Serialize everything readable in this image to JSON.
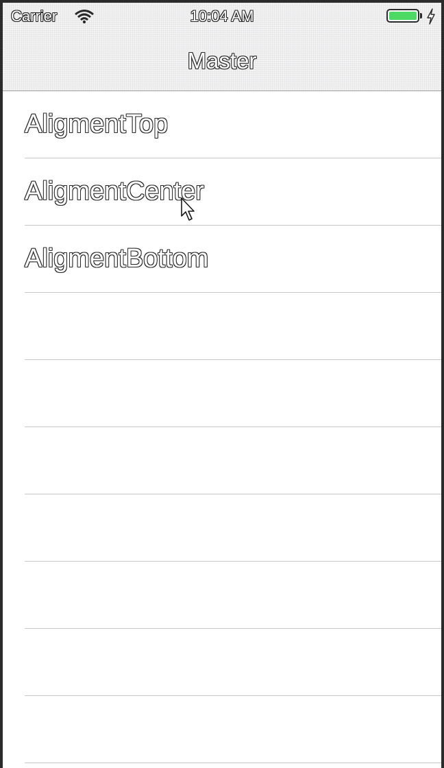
{
  "status_bar": {
    "carrier": "Carrier",
    "time": "10:04 AM",
    "battery_color": "#4cd964",
    "icons": [
      "wifi-icon",
      "battery-icon",
      "charging-bolt-icon"
    ]
  },
  "nav_bar": {
    "title": "Master"
  },
  "list": {
    "rows": [
      {
        "label": "AligmentTop"
      },
      {
        "label": "AligmentCenter"
      },
      {
        "label": "AligmentBottom"
      },
      {
        "label": ""
      },
      {
        "label": ""
      },
      {
        "label": ""
      },
      {
        "label": ""
      },
      {
        "label": ""
      },
      {
        "label": ""
      },
      {
        "label": ""
      }
    ]
  }
}
